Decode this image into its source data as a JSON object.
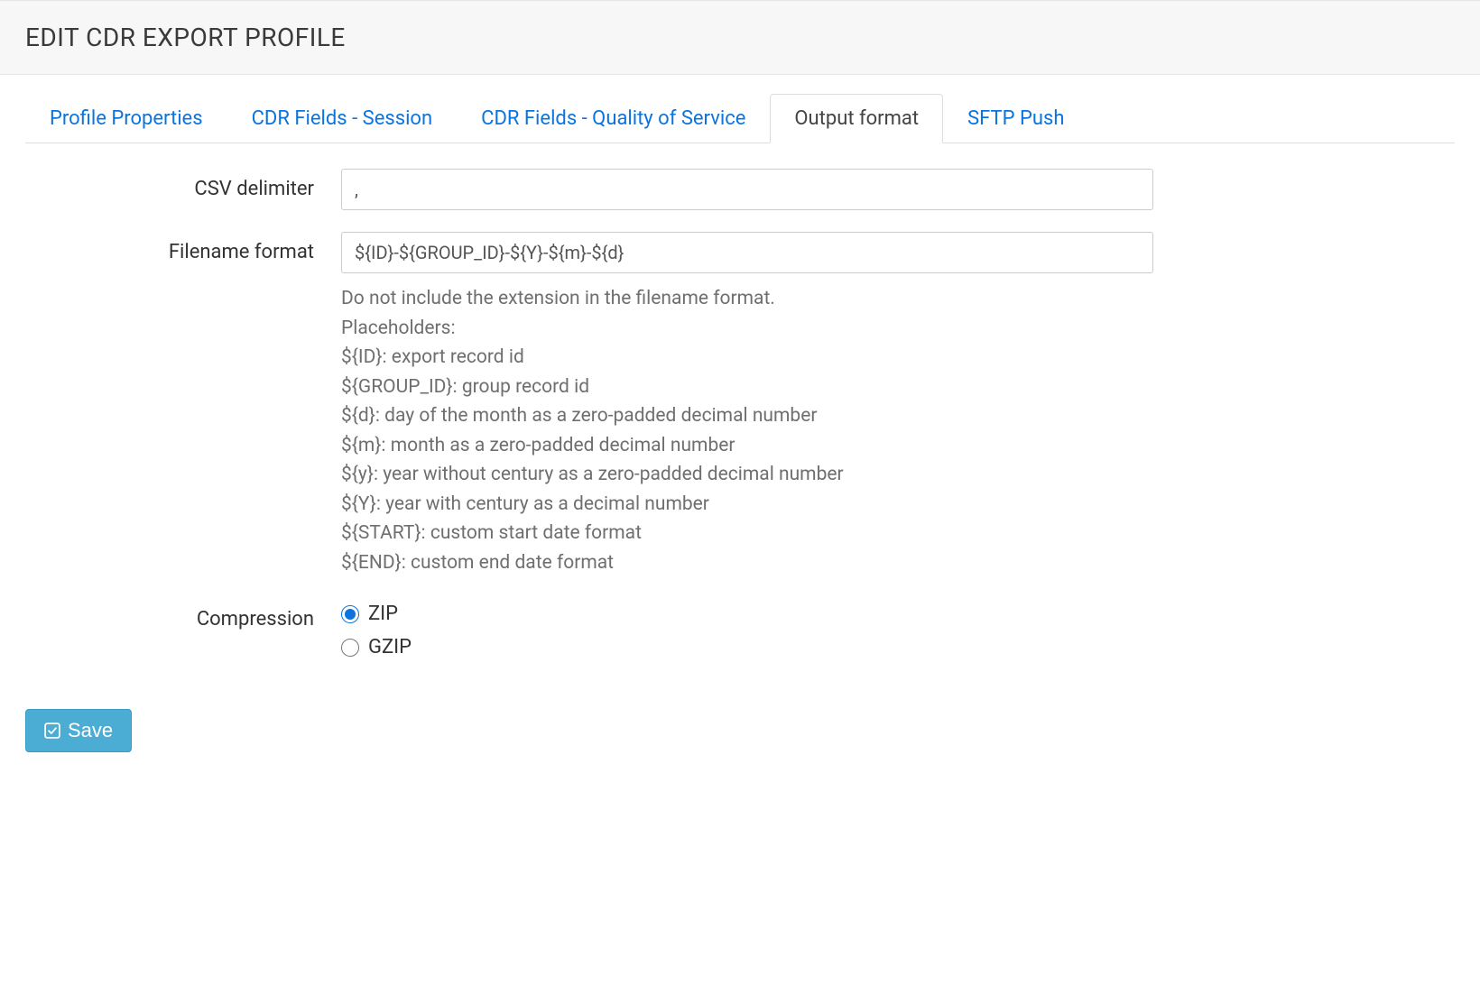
{
  "header": {
    "title": "EDIT CDR EXPORT PROFILE"
  },
  "tabs": [
    {
      "label": "Profile Properties",
      "active": false
    },
    {
      "label": "CDR Fields - Session",
      "active": false
    },
    {
      "label": "CDR Fields - Quality of Service",
      "active": false
    },
    {
      "label": "Output format",
      "active": true
    },
    {
      "label": "SFTP Push",
      "active": false
    }
  ],
  "form": {
    "csv_delimiter": {
      "label": "CSV delimiter",
      "value": ","
    },
    "filename_format": {
      "label": "Filename format",
      "value": "${ID}-${GROUP_ID}-${Y}-${m}-${d}",
      "help_lines": [
        "Do not include the extension in the filename format.",
        "Placeholders:",
        "${ID}: export record id",
        "${GROUP_ID}: group record id",
        "${d}: day of the month as a zero-padded decimal number",
        "${m}: month as a zero-padded decimal number",
        "${y}: year without century as a zero-padded decimal number",
        "${Y}: year with century as a decimal number",
        "${START}: custom start date format",
        "${END}: custom end date format"
      ]
    },
    "compression": {
      "label": "Compression",
      "options": [
        {
          "label": "ZIP",
          "checked": true
        },
        {
          "label": "GZIP",
          "checked": false
        }
      ]
    }
  },
  "buttons": {
    "save": "Save"
  }
}
